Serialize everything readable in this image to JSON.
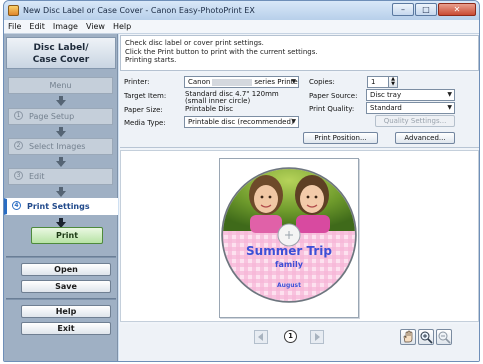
{
  "window": {
    "title": "New Disc Label or Case Cover - Canon Easy-PhotoPrint EX",
    "controls": {
      "minimize": "–",
      "maximize": "□",
      "close": "✕"
    }
  },
  "menubar": {
    "items": [
      "File",
      "Edit",
      "Image",
      "View",
      "Help"
    ]
  },
  "sidebar": {
    "title_line1": "Disc Label/",
    "title_line2": "Case Cover",
    "menu_label": "Menu",
    "steps": [
      {
        "num": "1",
        "label": "Page Setup",
        "active": false
      },
      {
        "num": "2",
        "label": "Select Images",
        "active": false
      },
      {
        "num": "3",
        "label": "Edit",
        "active": false
      },
      {
        "num": "4",
        "label": "Print Settings",
        "active": true
      }
    ],
    "print_label": "Print",
    "open_label": "Open",
    "save_label": "Save",
    "help_label": "Help",
    "exit_label": "Exit"
  },
  "instructions": {
    "line1": "Check disc label or cover print settings.",
    "line2": "Click the Print button to print with the current settings.",
    "line3": "Printing starts."
  },
  "settings": {
    "printer_label": "Printer:",
    "printer_prefix": "Canon",
    "printer_suffix": "series Printer",
    "target_label": "Target Item:",
    "target_value1": "Standard disc 4.7\" 120mm",
    "target_value2": "(small inner circle)",
    "paper_size_label": "Paper Size:",
    "paper_size_value": "Printable Disc",
    "media_type_label": "Media Type:",
    "media_type_value": "Printable disc (recommended)",
    "copies_label": "Copies:",
    "copies_value": "1",
    "paper_source_label": "Paper Source:",
    "paper_source_value": "Disc tray",
    "print_quality_label": "Print Quality:",
    "print_quality_value": "Standard",
    "quality_settings_label": "Quality Settings...",
    "print_position_label": "Print Position...",
    "advanced_label": "Advanced..."
  },
  "disc": {
    "title": "Summer Trip",
    "subtitle": "family",
    "month": "August",
    "colors": {
      "check_pink": "#f7b6d8",
      "check_light": "#fde1ef",
      "title_blue": "#3c4fd6"
    }
  },
  "pager": {
    "current_page": "1"
  },
  "icons": {
    "prev": "triangle-left",
    "next": "triangle-right",
    "hand": "hand-tool",
    "zoom_in": "magnifier-plus",
    "zoom_out": "magnifier-minus"
  }
}
